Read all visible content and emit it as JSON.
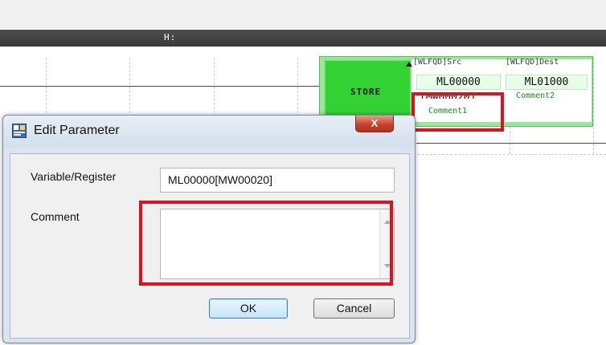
{
  "ladder": {
    "header_label": "H:",
    "block": {
      "instruction": "STORE",
      "src_label": "[WLFQD]Src",
      "dest_label": "[WLFQD]Dest",
      "src_value": "ML00000",
      "src_register": "[MW00020]",
      "src_comment": "Comment1",
      "dest_value": "ML01000",
      "dest_comment": "Comment2"
    }
  },
  "dialog": {
    "title": "Edit Parameter",
    "close_label": "X",
    "variable_label": "Variable/Register",
    "variable_value": "ML00000[MW00020]",
    "comment_label": "Comment",
    "comment_value": "",
    "ok_label": "OK",
    "cancel_label": "Cancel"
  },
  "colors": {
    "highlight": "#e0101c",
    "block_green": "#33d233",
    "comment_green": "#1a8a1a"
  }
}
